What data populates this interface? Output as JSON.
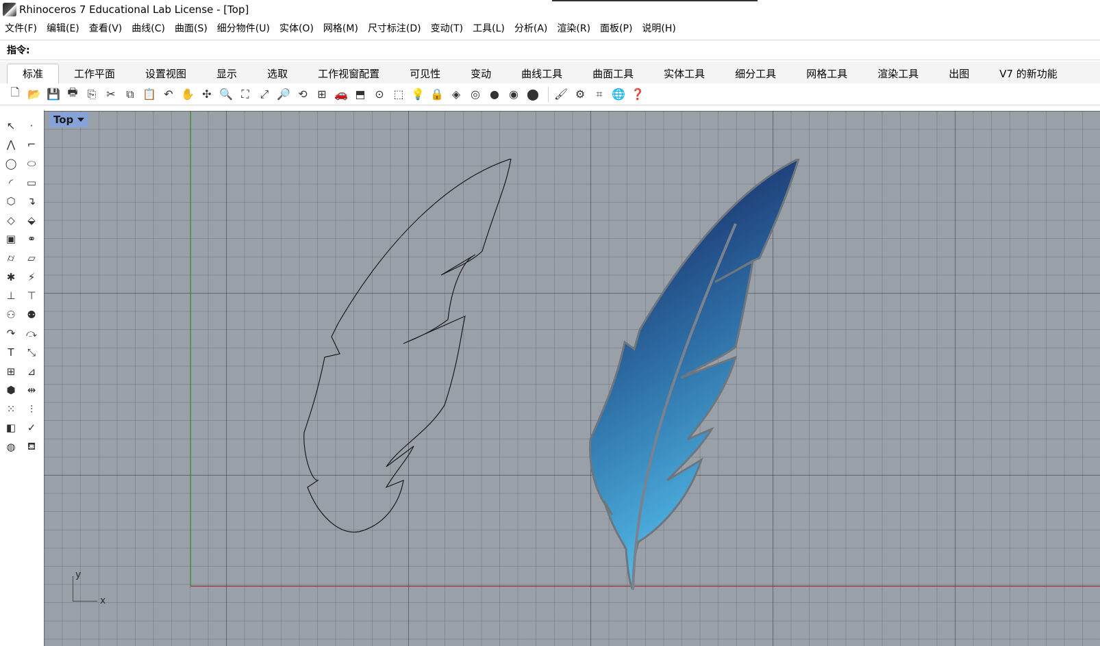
{
  "window": {
    "title": "Rhinoceros 7 Educational Lab License - [Top]"
  },
  "menubar": [
    "文件(F)",
    "编辑(E)",
    "查看(V)",
    "曲线(C)",
    "曲面(S)",
    "细分物件(U)",
    "实体(O)",
    "网格(M)",
    "尺寸标注(D)",
    "变动(T)",
    "工具(L)",
    "分析(A)",
    "渲染(R)",
    "面板(P)",
    "说明(H)"
  ],
  "command": {
    "label": "指令:",
    "value": ""
  },
  "tabs": [
    "标准",
    "工作平面",
    "设置视图",
    "显示",
    "选取",
    "工作视窗配置",
    "可见性",
    "变动",
    "曲线工具",
    "曲面工具",
    "实体工具",
    "细分工具",
    "网格工具",
    "渲染工具",
    "出图",
    "V7 的新功能"
  ],
  "viewport": {
    "name": "Top",
    "axis_labels": {
      "x": "x",
      "y": "y"
    },
    "colors": {
      "background": "#9aa0a8",
      "x_axis": "#8c1c1c",
      "y_axis": "#2a9a2a"
    }
  }
}
